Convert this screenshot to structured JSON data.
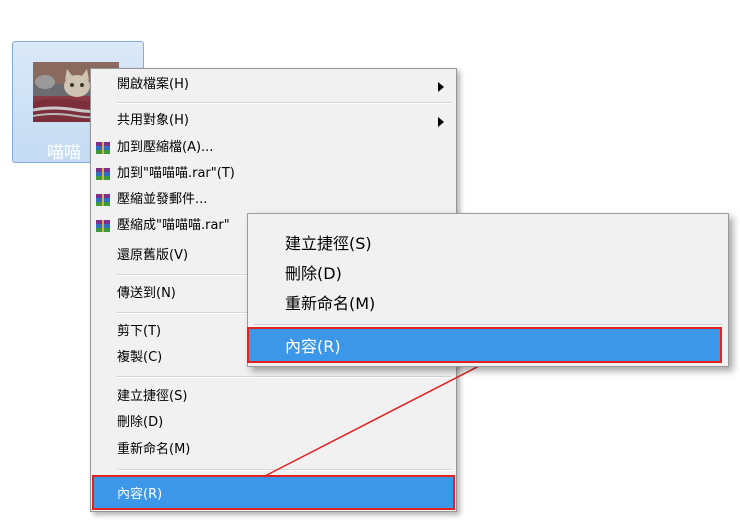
{
  "file": {
    "name": "喵喵",
    "icon": "cat-image-thumbnail"
  },
  "menu": {
    "items": [
      {
        "label": "開啟檔案(H)",
        "submenu": true,
        "bold": true
      },
      {
        "label": "共用對象(H)",
        "submenu": true,
        "bold": true
      },
      {
        "label": "加到壓縮檔(A)...",
        "icon": "winrar-icon"
      },
      {
        "label": "加到\"喵喵喵.rar\"(T)",
        "icon": "winrar-icon"
      },
      {
        "label": "壓縮並發郵件...",
        "icon": "winrar-icon"
      },
      {
        "label": "壓縮成\"喵喵喵.rar\"",
        "icon": "winrar-icon"
      },
      {
        "label": "還原舊版(V)"
      },
      {
        "label": "傳送到(N)"
      },
      {
        "label": "剪下(T)"
      },
      {
        "label": "複製(C)"
      },
      {
        "label": "建立捷徑(S)"
      },
      {
        "label": "刪除(D)"
      },
      {
        "label": "重新命名(M)"
      }
    ],
    "highlighted": {
      "label": "內容(R)"
    }
  },
  "popup": {
    "items": [
      {
        "label": "建立捷徑(S)"
      },
      {
        "label": "刪除(D)"
      },
      {
        "label": "重新命名(M)"
      }
    ],
    "highlighted": {
      "label": "內容(R)"
    }
  },
  "colors": {
    "highlight": "#3d97e8",
    "annotation": "#e3211f",
    "menu_bg": "#f1f1f1"
  }
}
